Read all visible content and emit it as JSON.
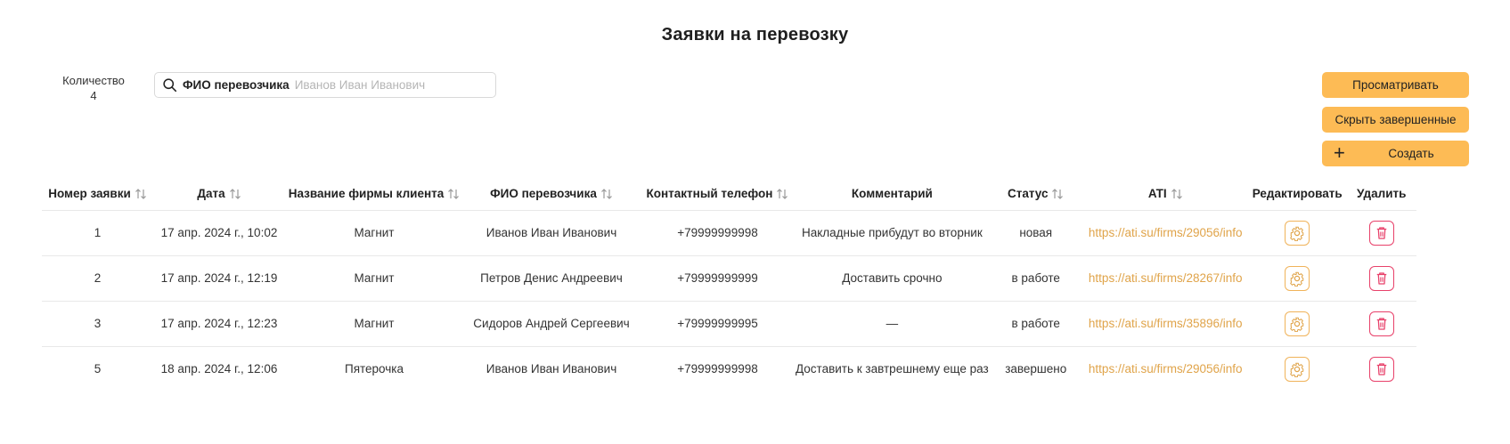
{
  "page": {
    "title": "Заявки на перевозку"
  },
  "count": {
    "label": "Количество",
    "value": "4"
  },
  "search": {
    "label": "ФИО перевозчика",
    "placeholder": "Иванов Иван Иванович",
    "value": ""
  },
  "buttons": {
    "view": "Просматривать",
    "hide_completed": "Скрыть завершенные",
    "create": "Создать"
  },
  "table": {
    "headers": {
      "number": "Номер заявки",
      "date": "Дата",
      "client": "Название фирмы клиента",
      "carrier": "ФИО перевозчика",
      "phone": "Контактный телефон",
      "comment": "Комментарий",
      "status": "Статус",
      "ati": "ATI",
      "edit": "Редактировать",
      "delete": "Удалить"
    },
    "rows": [
      {
        "number": "1",
        "date": "17 апр. 2024 г., 10:02",
        "client": "Магнит",
        "carrier": "Иванов Иван Иванович",
        "phone": "+79999999998",
        "comment": "Накладные прибудут во вторник",
        "status": "новая",
        "ati": "https://ati.su/firms/29056/info"
      },
      {
        "number": "2",
        "date": "17 апр. 2024 г., 12:19",
        "client": "Магнит",
        "carrier": "Петров Денис Андреевич",
        "phone": "+79999999999",
        "comment": "Доставить срочно",
        "status": "в работе",
        "ati": "https://ati.su/firms/28267/info"
      },
      {
        "number": "3",
        "date": "17 апр. 2024 г., 12:23",
        "client": "Магнит",
        "carrier": "Сидоров Андрей Сергеевич",
        "phone": "+79999999995",
        "comment": "—",
        "status": "в работе",
        "ati": "https://ati.su/firms/35896/info"
      },
      {
        "number": "5",
        "date": "18 апр. 2024 г., 12:06",
        "client": "Пятерочка",
        "carrier": "Иванов Иван Иванович",
        "phone": "+79999999998",
        "comment": "Доставить к завтрешнему еще раз",
        "status": "завершено",
        "ati": "https://ati.su/firms/29056/info"
      }
    ]
  },
  "colors": {
    "accent": "#fdbb55",
    "link": "#e0a44a",
    "delete": "#e8416a"
  },
  "icons": {
    "search": "search-icon",
    "sort": "sort-arrows-icon",
    "edit": "gear-icon",
    "delete": "trash-icon",
    "create": "plus-icon"
  }
}
